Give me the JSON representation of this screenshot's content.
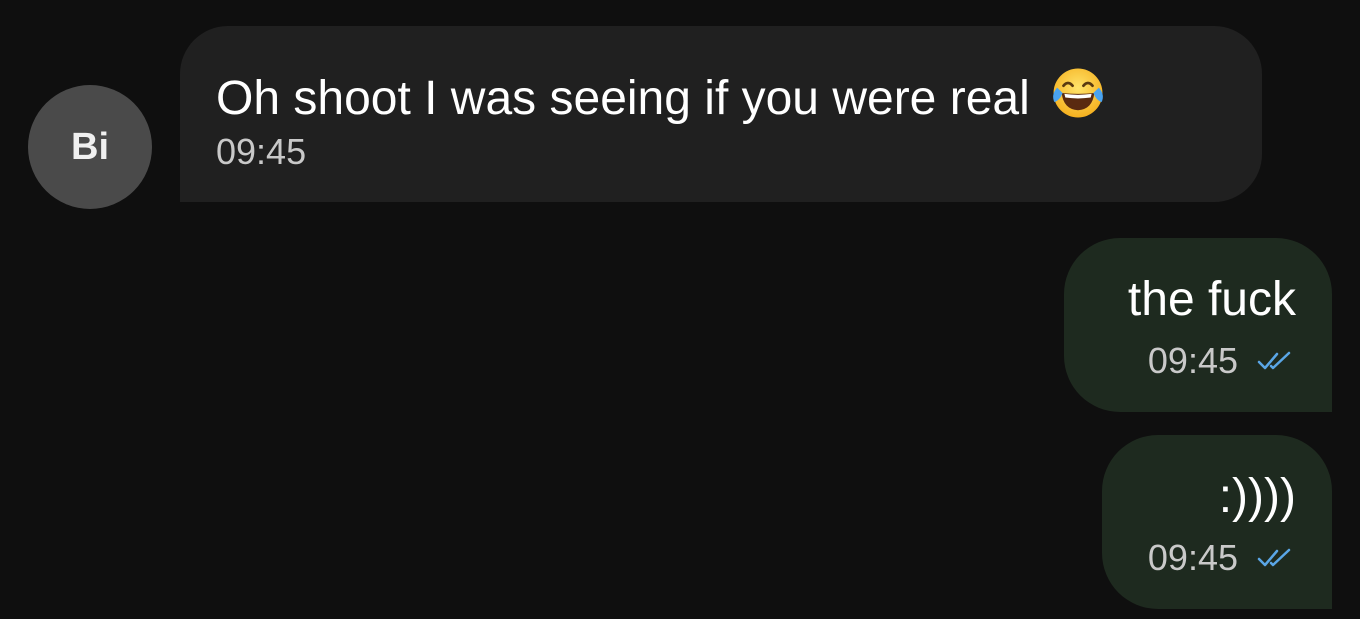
{
  "contact": {
    "avatar_initials": "Bi"
  },
  "messages": [
    {
      "direction": "incoming",
      "text": "Oh shoot I was seeing if you were real",
      "emoji": "face-with-tears-of-joy-icon",
      "time": "09:45"
    },
    {
      "direction": "outgoing",
      "text": "the fuck",
      "time": "09:45",
      "status": "read-double-check-icon"
    },
    {
      "direction": "outgoing",
      "text": ":))))",
      "time": "09:45",
      "status": "read-double-check-icon"
    }
  ],
  "colors": {
    "background": "#0f0f0f",
    "incoming_bubble": "#202020",
    "outgoing_bubble": "#1e2a1f",
    "avatar": "#4a4a4a",
    "read_check": "#5aa6e6"
  }
}
